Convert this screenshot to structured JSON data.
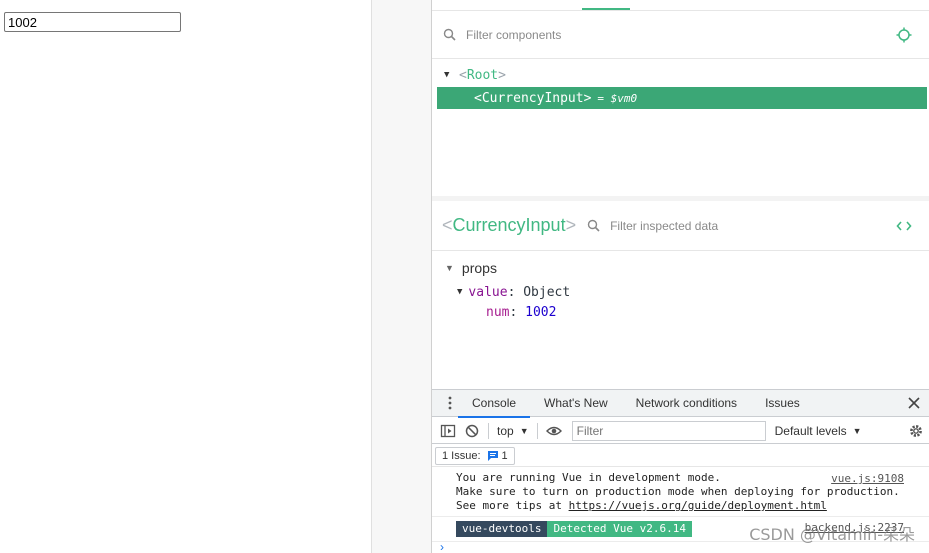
{
  "app": {
    "input_value": "1002"
  },
  "components": {
    "filter_placeholder": "Filter components",
    "root_name": "Root",
    "selected_component": "CurrencyInput",
    "vm_label": "= $vm0"
  },
  "inspector": {
    "component_name": "CurrencyInput",
    "filter_placeholder": "Filter inspected data",
    "section_label": "props",
    "value_key": "value",
    "value_type": "Object",
    "num_key": "num",
    "num_value": "1002"
  },
  "drawer": {
    "tabs": [
      {
        "label": "Console",
        "active": true
      },
      {
        "label": "What's New",
        "active": false
      },
      {
        "label": "Network conditions",
        "active": false
      },
      {
        "label": "Issues",
        "active": false
      }
    ]
  },
  "console": {
    "context": "top",
    "filter_placeholder": "Filter",
    "levels_label": "Default levels",
    "issues_label": "1 Issue:",
    "issues_count": "1",
    "messages": {
      "line1": "You are running Vue in development mode.",
      "line2": "Make sure to turn on production mode when deploying for production.",
      "line3_prefix": "See more tips at ",
      "line3_link": "https://vuejs.org/guide/deployment.html",
      "source1": "vue.js:9108",
      "devtools_badge": "vue-devtools",
      "detected_badge": "Detected Vue v2.6.14",
      "source2": "backend.js:2237"
    },
    "prompt": "›"
  },
  "watermark": "CSDN @Vitamin-朵朵",
  "colors": {
    "vue_green": "#41b883",
    "selected_row": "#3ba776",
    "vue_dark": "#35495e",
    "active_tab": "#1a73e8"
  }
}
